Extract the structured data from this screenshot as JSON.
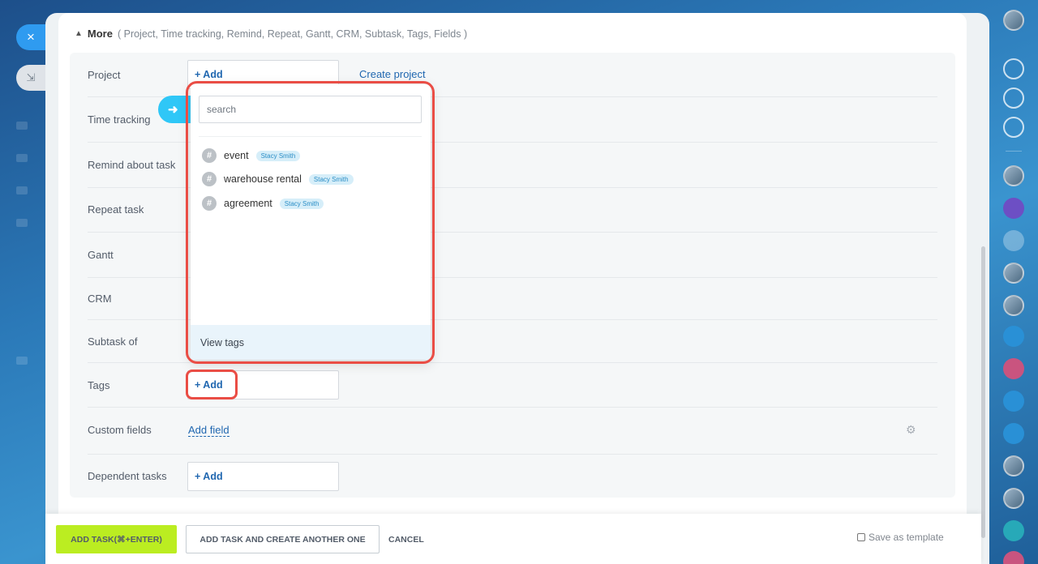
{
  "nav": {
    "close_icon": "×",
    "minimize_icon": "⇲"
  },
  "more": {
    "label": "More",
    "subtitle": "( Project,  Time tracking,  Remind,  Repeat,  Gantt,  CRM,  Subtask,  Tags,  Fields )"
  },
  "fields": {
    "project": "Project",
    "time_tracking": "Time tracking",
    "remind": "Remind about task",
    "repeat": "Repeat task",
    "gantt": "Gantt",
    "crm": "CRM",
    "subtask": "Subtask of",
    "tags": "Tags",
    "custom_fields": "Custom fields",
    "dependent": "Dependent tasks"
  },
  "actions": {
    "add": "+ Add",
    "create_project": "Create project",
    "add_field": "Add field"
  },
  "tag_popup": {
    "search_placeholder": "search",
    "tags": [
      {
        "name": "event",
        "owner": "Stacy Smith"
      },
      {
        "name": "warehouse rental",
        "owner": "Stacy Smith"
      },
      {
        "name": "agreement",
        "owner": "Stacy Smith"
      }
    ],
    "view_tags": "View tags"
  },
  "footer": {
    "add_task": "ADD TASK(⌘+ENTER)",
    "add_another": "ADD TASK AND CREATE ANOTHER ONE",
    "cancel": "CANCEL",
    "save_template": "Save as template"
  },
  "colors": {
    "accent": "#2067b0",
    "primary_button": "#bbed21",
    "highlight": "#ea4d45"
  }
}
